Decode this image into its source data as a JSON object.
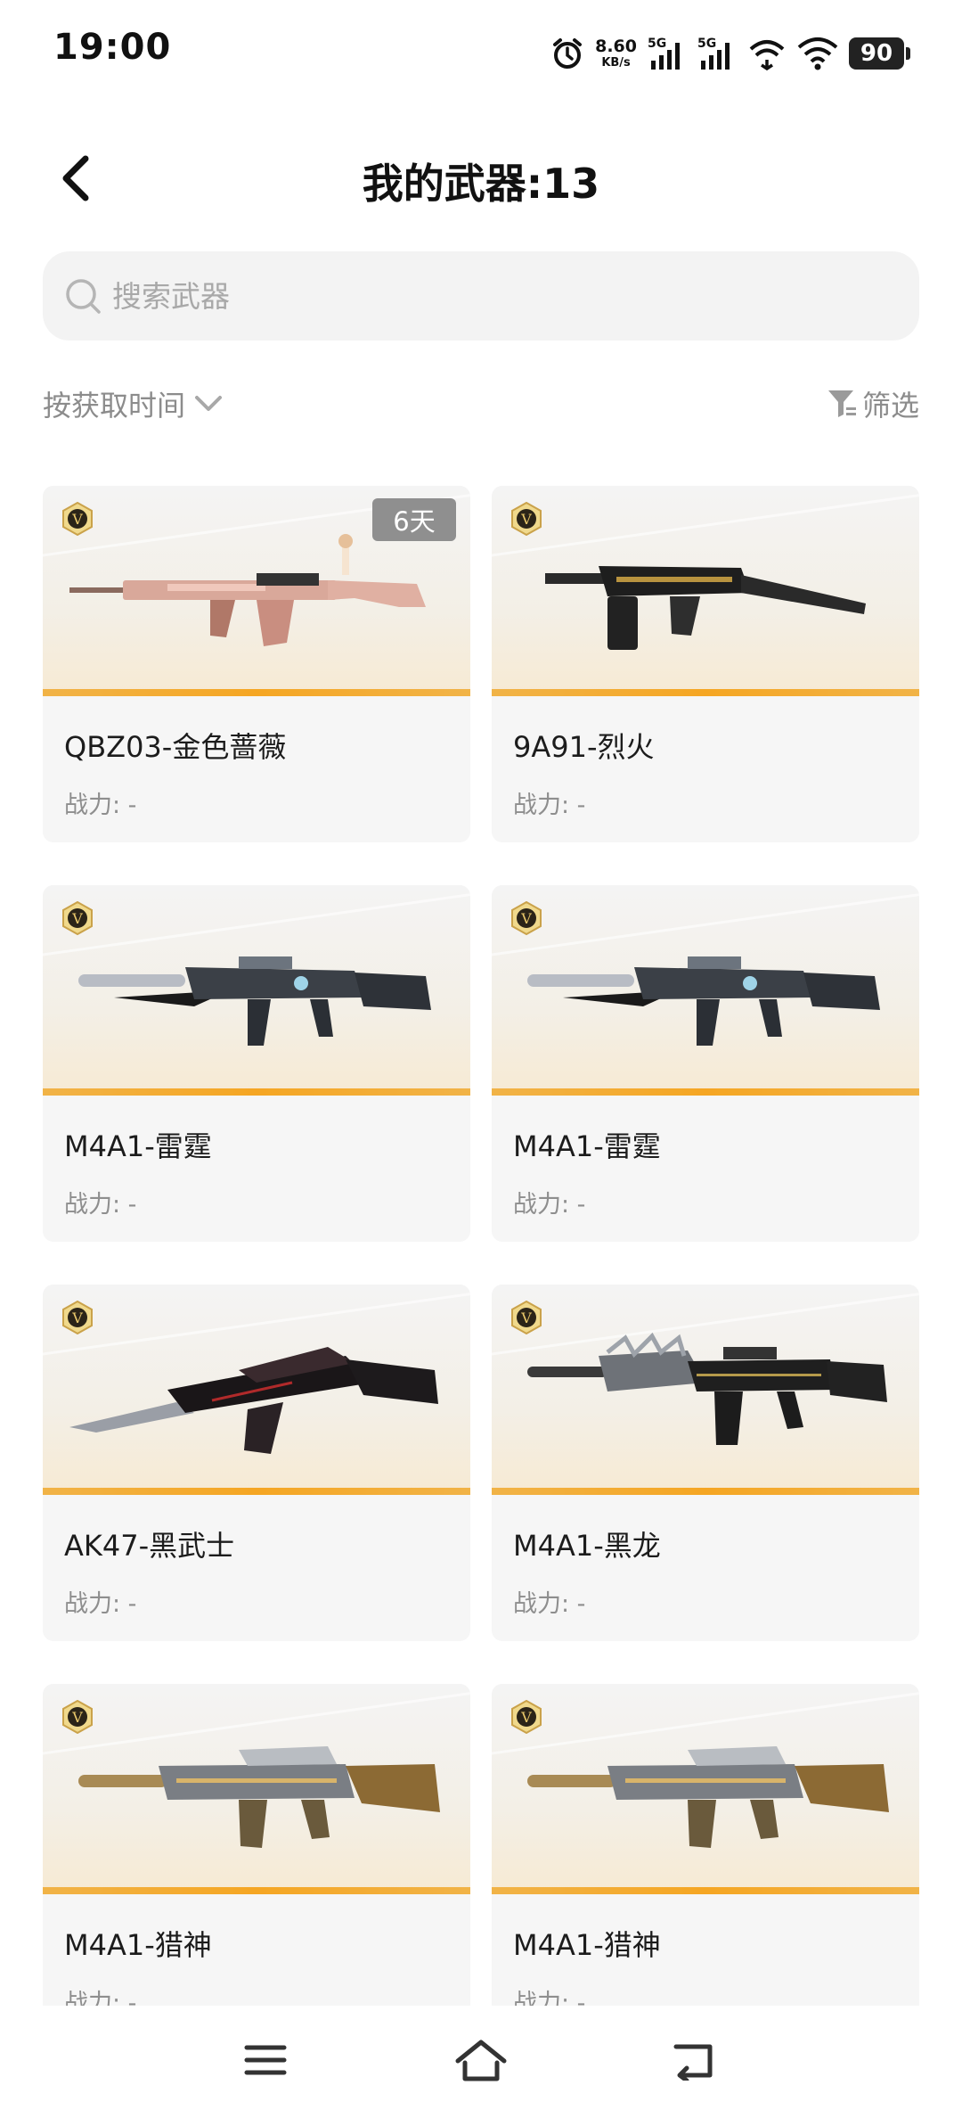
{
  "status_bar": {
    "time": "19:00",
    "net_speed_value": "8.60",
    "net_speed_unit": "KB/s",
    "sim1_label": "5G",
    "sim2_label": "5G",
    "battery": "90",
    "icons": [
      "alarm-icon",
      "signal-icon",
      "signal-icon",
      "hotspot-icon",
      "wifi-icon",
      "battery-icon"
    ]
  },
  "header": {
    "title": "我的武器:13",
    "back_icon": "chevron-left-icon"
  },
  "search": {
    "placeholder": "搜索武器",
    "icon": "search-icon"
  },
  "toolbar": {
    "sort_label": "按获取时间",
    "filter_label": "筛选"
  },
  "weapons": [
    {
      "name": "QBZ03-金色蔷薇",
      "power": "战力: -",
      "tag": "6天",
      "style": "pink"
    },
    {
      "name": "9A91-烈火",
      "power": "战力: -",
      "style": "blackgold"
    },
    {
      "name": "M4A1-雷霆",
      "power": "战力: -",
      "style": "thunder"
    },
    {
      "name": "M4A1-雷霆",
      "power": "战力: -",
      "style": "thunder"
    },
    {
      "name": "AK47-黑武士",
      "power": "战力: -",
      "style": "blackred"
    },
    {
      "name": "M4A1-黑龙",
      "power": "战力: -",
      "style": "dragon"
    },
    {
      "name": "M4A1-猎神",
      "power": "战力: -",
      "style": "hunter"
    },
    {
      "name": "M4A1-猎神",
      "power": "战力: -",
      "style": "hunter"
    }
  ],
  "colors": {
    "accent_bar": "#f5a623",
    "card_bg": "#f6f6f6",
    "muted_text": "#8c8c8c"
  },
  "navbar": {
    "icons": [
      "menu-icon",
      "home-icon",
      "back-icon"
    ]
  }
}
